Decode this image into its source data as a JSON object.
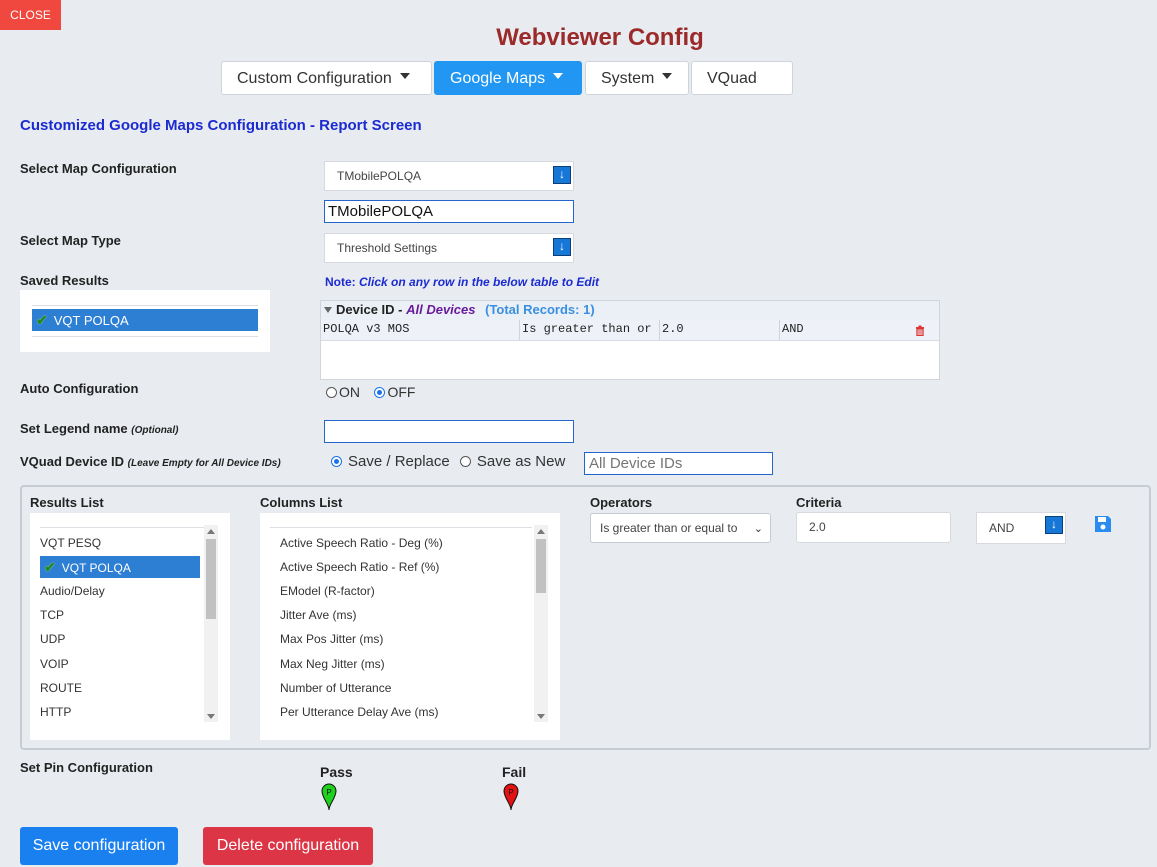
{
  "close_label": "CLOSE",
  "title": "Webviewer Config",
  "tabs": [
    {
      "label": "Custom Configuration"
    },
    {
      "label": "Google Maps"
    },
    {
      "label": "System"
    },
    {
      "label": "VQuad"
    }
  ],
  "section_heading": "Customized Google Maps Configuration - Report Screen",
  "fields": {
    "select_map_config_label": "Select Map Configuration",
    "map_config_value": "TMobilePOLQA",
    "map_config_name": "TMobilePOLQA",
    "select_map_type_label": "Select Map Type",
    "map_type_value": "Threshold Settings",
    "saved_results_label": "Saved Results",
    "saved_result_item": "VQT POLQA",
    "auto_config_label": "Auto Configuration",
    "auto_on": "ON",
    "auto_off": "OFF",
    "legend_label": "Set Legend name",
    "legend_optional": "(Optional)",
    "legend_value": "",
    "vquad_label": "VQuad Device ID",
    "vquad_hint": "(Leave Empty for All Device IDs)",
    "save_replace": "Save / Replace",
    "save_as_new": "Save as New",
    "device_ids_placeholder": "All Device IDs",
    "pin_label": "Set Pin Configuration",
    "pass": "Pass",
    "fail": "Fail"
  },
  "note": {
    "prefix": "Note:",
    "text": "Click on any row in the below table to Edit"
  },
  "grid": {
    "device_label": "Device ID -",
    "device_value": "All Devices",
    "total_records": "(Total Records: 1)",
    "row": [
      "POLQA v3 MOS",
      "Is greater than or",
      "2.0",
      "AND"
    ]
  },
  "panel": {
    "results_list_label": "Results List",
    "columns_list_label": "Columns List",
    "operators_label": "Operators",
    "criteria_label": "Criteria",
    "operator_value": "Is greater than or equal to",
    "criteria_value": "2.0",
    "logic_value": "AND",
    "results": [
      "VQT PESQ",
      "VQT POLQA",
      "Audio/Delay",
      "TCP",
      "UDP",
      "VOIP",
      "ROUTE",
      "HTTP"
    ],
    "columns": [
      "Active Speech Ratio - Deg (%)",
      "Active Speech Ratio - Ref (%)",
      "EModel (R-factor)",
      "Jitter Ave (ms)",
      "Max Pos Jitter (ms)",
      "Max Neg Jitter (ms)",
      "Number of Utterance",
      "Per Utterance Delay Ave (ms)"
    ]
  },
  "buttons": {
    "save": "Save configuration",
    "delete": "Delete configuration"
  },
  "colors": {
    "primary": "#2196f3",
    "danger": "#dc3545",
    "title": "#9b2a2a",
    "heading": "#1b2bd1",
    "close": "#f0483e"
  }
}
